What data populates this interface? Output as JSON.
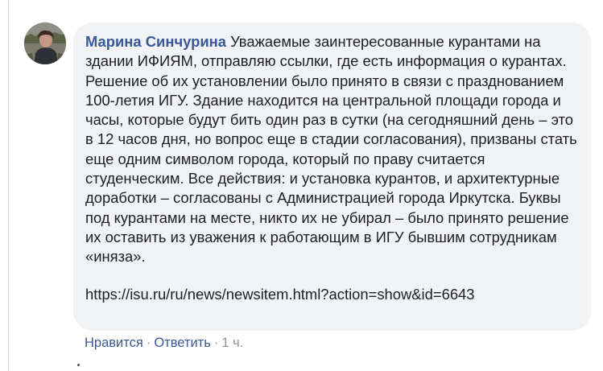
{
  "comment": {
    "author": "Марина Синчурина",
    "text": "Уважаемые заинтересованные курантами на здании ИФИЯМ, отправляю ссылки, где есть информация о курантах. Решение об их установлении было принято в связи с празднованием 100-летия ИГУ. Здание находится на центральной площади города и часы, которые будут бить один раз в сутки (на сегодняшний день – это в 12 часов дня, но вопрос еще в стадии согласования), призваны стать еще одним символом города, который по праву считается студенческим. Все действия: и установка курантов, и архитектурные доработки – согласованы с Администрацией города Иркутска. Буквы под курантами на месте, никто их не убирал – было принято решение их оставить из уважения к работающим в ИГУ бывшим сотрудникам «иняза».",
    "link": "https://isu.ru/ru/news/newsitem.html?action=show&id=6643"
  },
  "actions": {
    "like_label": "Нравится",
    "separator": "·",
    "reply_label": "Ответить",
    "time": "1 ч."
  },
  "colors": {
    "name_color": "#385898",
    "bubble_bg": "#f2f3f5",
    "text_color": "#1c1e21",
    "meta_color": "#90949c"
  }
}
